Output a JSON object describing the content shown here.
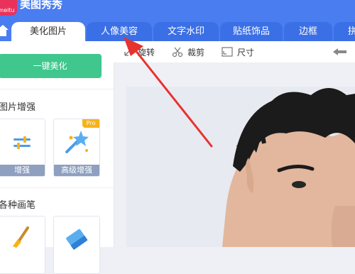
{
  "app": {
    "title": "美图秀秀",
    "logo_text": "meitu"
  },
  "tabs": [
    {
      "label": "美化图片",
      "active": true
    },
    {
      "label": "人像美容",
      "active": false
    },
    {
      "label": "文字水印",
      "active": false
    },
    {
      "label": "贴纸饰品",
      "active": false
    },
    {
      "label": "边框",
      "active": false
    },
    {
      "label": "拼",
      "active": false
    }
  ],
  "sidebar": {
    "one_key_label": "一键美化",
    "section_enhance": "图片增强",
    "tools_enhance": [
      {
        "label": "增强",
        "icon": "sliders-icon"
      },
      {
        "label": "高级增强",
        "icon": "magic-wand-icon",
        "badge": "Pro"
      }
    ],
    "section_brush": "各种画笔",
    "tools_brush": [
      {
        "icon": "paintbrush-icon"
      },
      {
        "icon": "eraser-icon"
      }
    ]
  },
  "toolbar": {
    "items": [
      {
        "label": "旋转",
        "icon": "rotate-icon"
      },
      {
        "label": "裁剪",
        "icon": "crop-icon"
      },
      {
        "label": "尺寸",
        "icon": "resize-icon"
      }
    ],
    "back_icon": "arrow-left-icon"
  },
  "colors": {
    "accent": "#4a7df0",
    "green": "#3fc78e",
    "annotation": "#e8322f",
    "pro": "#f6b319"
  }
}
